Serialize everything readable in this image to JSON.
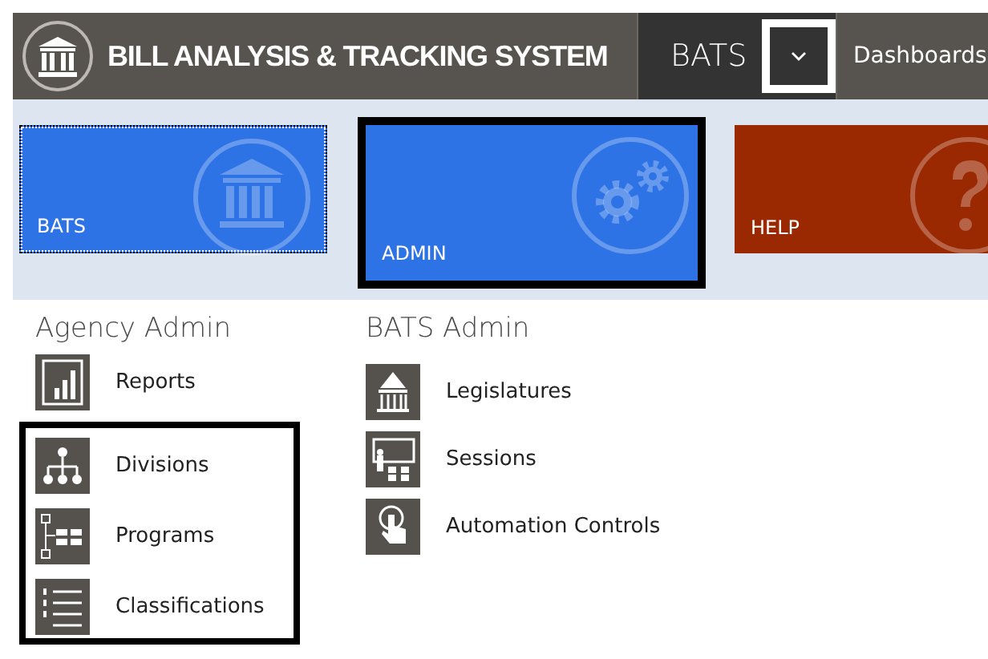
{
  "header": {
    "title": "BILL ANALYSIS & TRACKING SYSTEM",
    "app_switcher": {
      "label": "BATS",
      "highlighted": true
    },
    "nav": [
      "Dashboards"
    ]
  },
  "tiles": [
    {
      "label": "BATS",
      "color": "#2d73e6",
      "selected": false,
      "focused": true
    },
    {
      "label": "ADMIN",
      "color": "#2d73e6",
      "selected": true,
      "focused": false
    },
    {
      "label": "HELP",
      "color": "#9a2800",
      "selected": false,
      "focused": false
    }
  ],
  "sections": [
    {
      "title": "Agency Admin",
      "items": [
        {
          "label": "Reports",
          "highlighted": false
        },
        {
          "label": "Divisions",
          "highlighted": true
        },
        {
          "label": "Programs",
          "highlighted": true
        },
        {
          "label": "Classifications",
          "highlighted": true
        }
      ]
    },
    {
      "title": "BATS Admin",
      "items": [
        {
          "label": "Legislatures",
          "highlighted": false
        },
        {
          "label": "Sessions",
          "highlighted": false
        },
        {
          "label": "Automation Controls",
          "highlighted": false
        }
      ]
    }
  ]
}
